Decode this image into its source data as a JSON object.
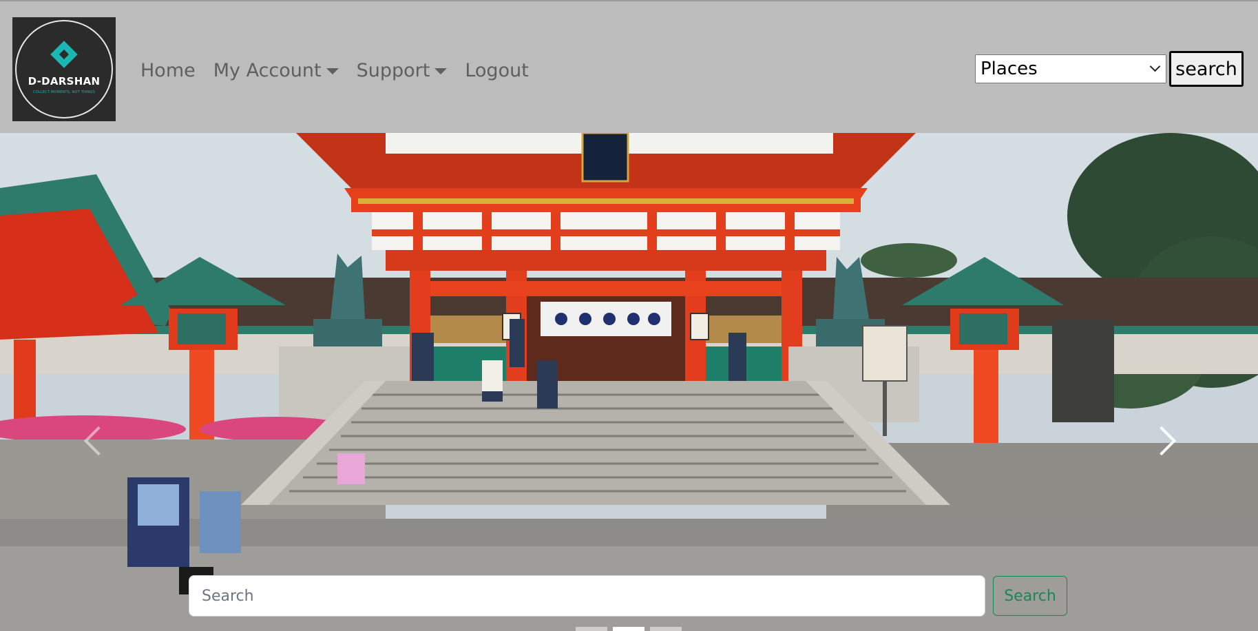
{
  "logo": {
    "title": "D-DARSHAN",
    "tagline": "COLLECT MOMENTS, NOT THINGS"
  },
  "nav": {
    "items": [
      {
        "label": "Home",
        "dropdown": false
      },
      {
        "label": "My Account",
        "dropdown": true
      },
      {
        "label": "Support",
        "dropdown": true
      },
      {
        "label": "Logout",
        "dropdown": false
      }
    ]
  },
  "places_select": {
    "selected": "Places"
  },
  "header_search_button": {
    "label": "search"
  },
  "hero_search": {
    "placeholder": "Search",
    "button_label": "Search"
  },
  "carousel": {
    "slide_count": 3,
    "active_index": 1
  },
  "colors": {
    "navbar_bg": "#bcbcbc",
    "shrine_red": "#e63c1c",
    "roof_teal": "#2e7a6b",
    "brand_teal": "#1bb8b3",
    "success_green": "#198754"
  }
}
